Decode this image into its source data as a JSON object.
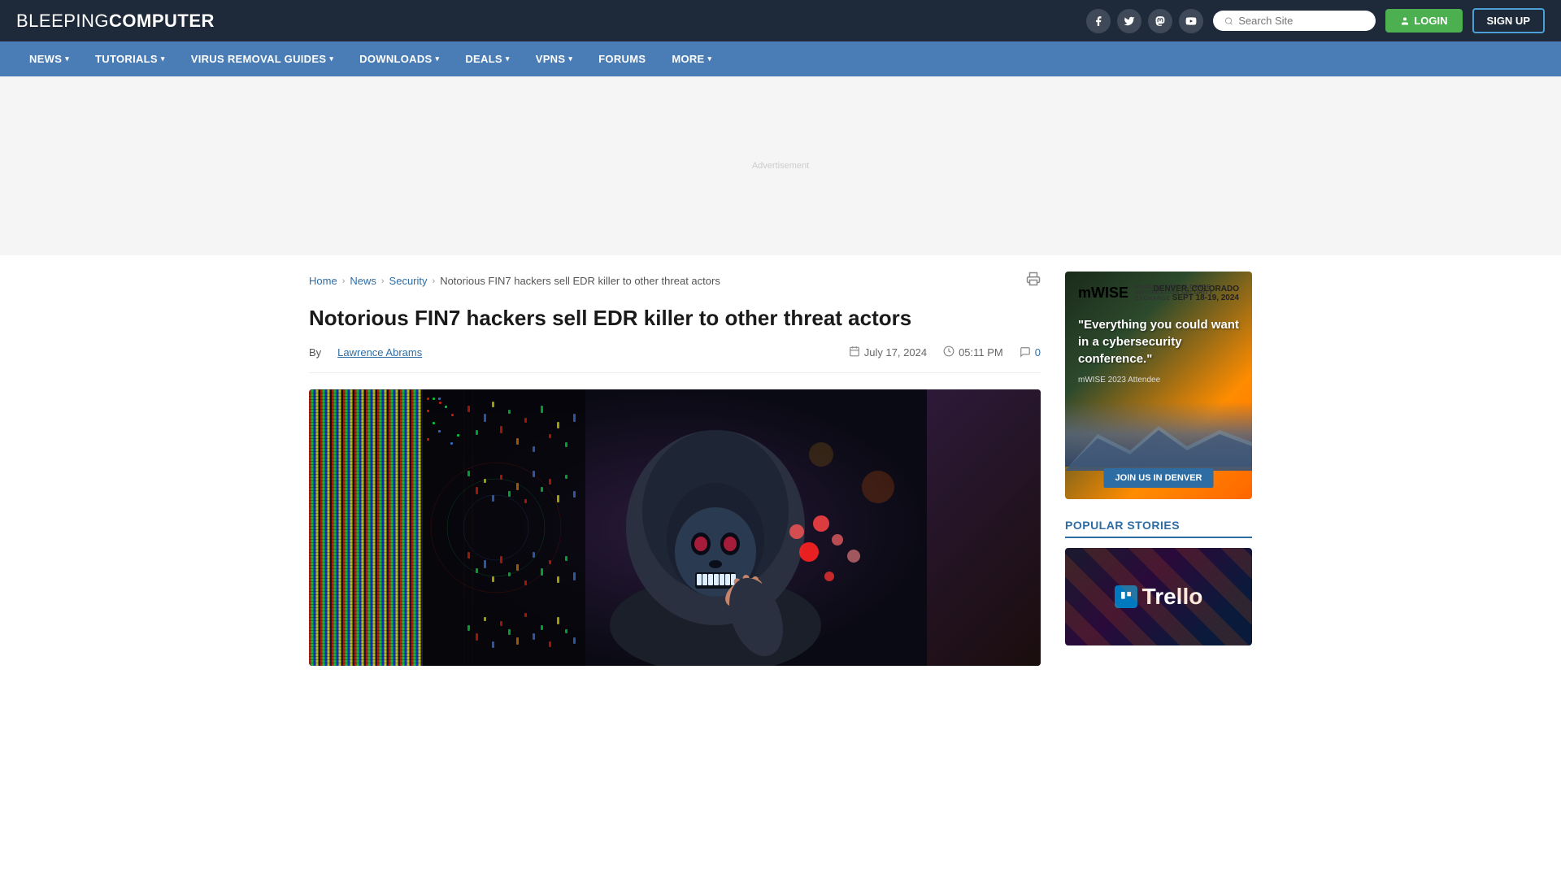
{
  "site": {
    "logo_regular": "BLEEPING",
    "logo_bold": "COMPUTER",
    "search_placeholder": "Search Site"
  },
  "header": {
    "login_label": "LOGIN",
    "signup_label": "SIGN UP",
    "social": [
      {
        "name": "facebook",
        "icon": "f"
      },
      {
        "name": "twitter",
        "icon": "𝕏"
      },
      {
        "name": "mastodon",
        "icon": "m"
      },
      {
        "name": "youtube",
        "icon": "▶"
      }
    ]
  },
  "nav": {
    "items": [
      {
        "label": "NEWS",
        "has_dropdown": true
      },
      {
        "label": "TUTORIALS",
        "has_dropdown": true
      },
      {
        "label": "VIRUS REMOVAL GUIDES",
        "has_dropdown": true
      },
      {
        "label": "DOWNLOADS",
        "has_dropdown": true
      },
      {
        "label": "DEALS",
        "has_dropdown": true
      },
      {
        "label": "VPNS",
        "has_dropdown": true
      },
      {
        "label": "FORUMS",
        "has_dropdown": false
      },
      {
        "label": "MORE",
        "has_dropdown": true
      }
    ]
  },
  "breadcrumb": {
    "home": "Home",
    "news": "News",
    "security": "Security",
    "current": "Notorious FIN7 hackers sell EDR killer to other threat actors"
  },
  "article": {
    "title": "Notorious FIN7 hackers sell EDR killer to other threat actors",
    "author": "Lawrence Abrams",
    "by_label": "By",
    "date": "July 17, 2024",
    "time": "05:11 PM",
    "comments_count": "0",
    "image_alt": "Hacker with skull mask in front of LED display wall"
  },
  "sidebar": {
    "ad": {
      "logo": "mWISE",
      "logo_sub": "MANDIANT WORLDWIDE\nINFORMATION SECURITY EXCHANGE",
      "location": "DENVER, COLORADO\nSEPT 18-19, 2024",
      "quote": "\"Everything you could want in a cybersecurity conference.\"",
      "attrib": "mWISE 2023 Attendee",
      "cta": "JOIN US IN DENVER"
    },
    "popular_stories": {
      "title": "POPULAR STORIES",
      "items": [
        {
          "title": "Trello",
          "image_type": "trello"
        }
      ]
    }
  },
  "colors": {
    "header_bg": "#1e2a3a",
    "nav_bg": "#4a7db5",
    "accent_blue": "#2e6da4",
    "accent_green": "#4caf50"
  }
}
